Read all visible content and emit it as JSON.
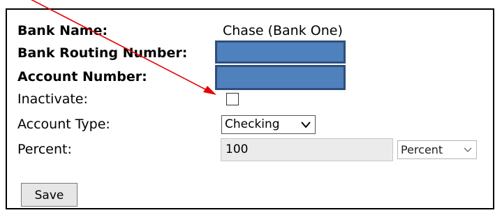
{
  "form": {
    "bank_name_label": "Bank Name:",
    "bank_name_value": "Chase (Bank One)",
    "routing_label": "Bank Routing Number:",
    "account_label": "Account Number:",
    "inactivate_label": "Inactivate:",
    "inactivate_checked": false,
    "account_type_label": "Account Type:",
    "account_type_value": "Checking",
    "percent_label": "Percent:",
    "percent_value": "100",
    "percent_unit_value": "Percent",
    "save_label": "Save"
  },
  "colors": {
    "redaction_fill": "#4f81bd",
    "annotation_arrow": "#e60000"
  },
  "icons": {
    "select_chevron": "chevron-down-icon",
    "annotation": "red-arrow-icon"
  }
}
